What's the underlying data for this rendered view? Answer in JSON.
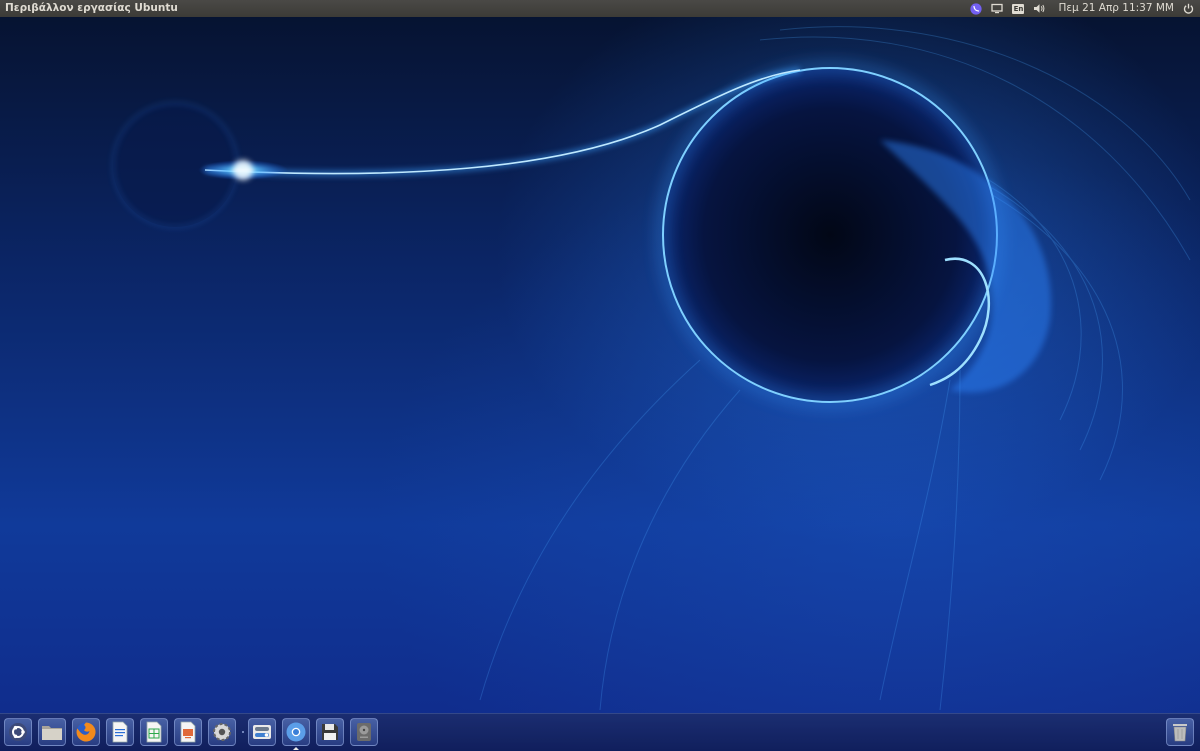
{
  "top_panel": {
    "window_title": "Περιβάλλον εργασίας Ubuntu",
    "indicators": {
      "viber": "viber-icon",
      "display": "display-icon",
      "keyboard_layout": "En",
      "volume": "volume-icon",
      "clock": "Πεμ 21 Απρ 11:37 ΜΜ",
      "session": "power-icon"
    }
  },
  "launcher": {
    "items": [
      {
        "name": "dash-home",
        "icon": "ubuntu-logo-icon",
        "running": false
      },
      {
        "name": "files",
        "icon": "folder-icon",
        "running": false
      },
      {
        "name": "firefox",
        "icon": "firefox-icon",
        "running": false
      },
      {
        "name": "libreoffice-writer",
        "icon": "writer-document-icon",
        "running": false
      },
      {
        "name": "libreoffice-calc",
        "icon": "calc-spreadsheet-icon",
        "running": false
      },
      {
        "name": "libreoffice-impress",
        "icon": "impress-presentation-icon",
        "running": false
      },
      {
        "name": "system-settings",
        "icon": "gear-icon",
        "running": false
      },
      {
        "name": "software-updater",
        "icon": "toggle-updater-icon",
        "running": false
      },
      {
        "name": "chromium",
        "icon": "chromium-icon",
        "running": true
      },
      {
        "name": "floppy-save",
        "icon": "floppy-disk-icon",
        "running": false
      },
      {
        "name": "disk-drive",
        "icon": "hard-drive-icon",
        "running": false
      },
      {
        "name": "trash",
        "icon": "trash-icon",
        "running": false
      }
    ]
  },
  "colors": {
    "panel_bg": "#3c3b37",
    "panel_text": "#dfdbd2",
    "viber_purple": "#7360f2",
    "wallpaper_glow": "#3aa0ff"
  }
}
